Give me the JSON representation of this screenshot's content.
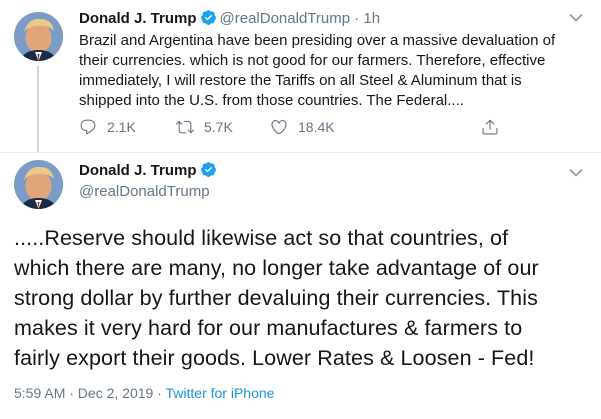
{
  "tweet1": {
    "name": "Donald J. Trump",
    "handle": "@realDonaldTrump",
    "separator": "·",
    "time": "1h",
    "lines": [
      "Brazil and Argentina have been presiding over a massive devaluation of",
      "their currencies. which is not good for our farmers. Therefore, effective",
      "immediately, I will restore the Tariffs on all Steel & Aluminum that is",
      "shipped into the U.S. from those countries. The Federal...."
    ],
    "replies": "2.1K",
    "retweets": "5.7K",
    "likes": "18.4K",
    "icons": [
      "verified-badge-icon",
      "chevron-down-icon",
      "reply-icon",
      "retweet-icon",
      "like-icon",
      "share-icon"
    ]
  },
  "tweet2": {
    "name": "Donald J. Trump",
    "handle": "@realDonaldTrump",
    "lines": [
      ".....Reserve should likewise act so that countries, of",
      "which there are many, no longer take advantage of our",
      "strong dollar by further devaluing their currencies. This",
      "makes it very hard for our manufactures & farmers to",
      "fairly export their goods. Lower Rates & Loosen - Fed!"
    ],
    "timestamp": "5:59 AM · Dec 2, 2019 · ",
    "source": "Twitter for iPhone"
  },
  "colors": {
    "verified": "#1da1f2",
    "secondary_text": "#657786",
    "link": "#1b95e0",
    "divider": "#e6ecf0"
  }
}
